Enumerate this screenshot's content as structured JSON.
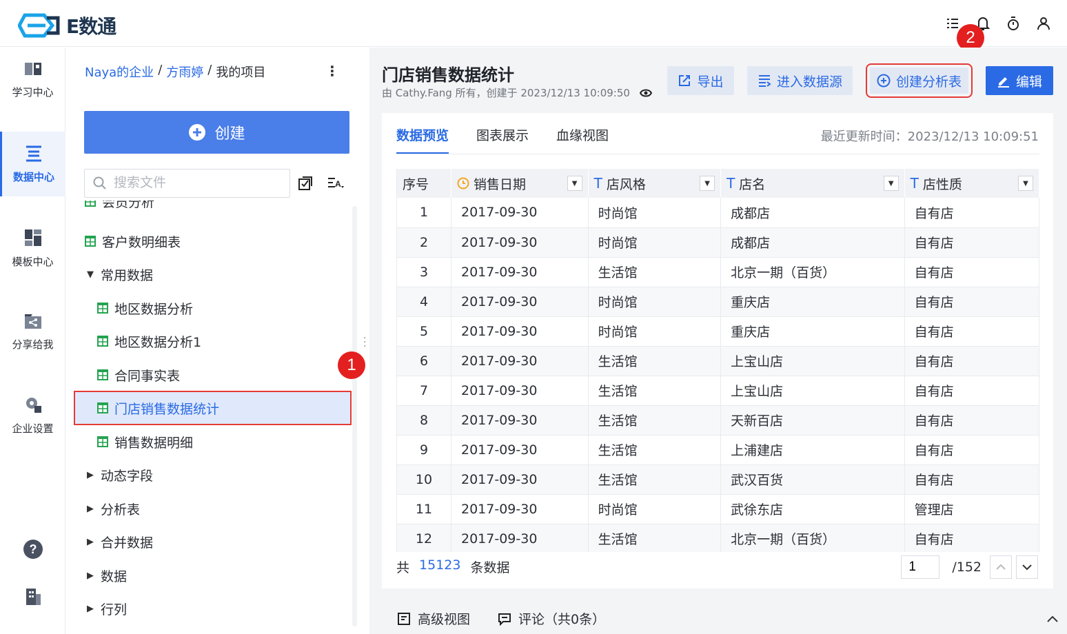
{
  "app": {
    "name": "E数通"
  },
  "nav": {
    "items": [
      {
        "label": "学习中心"
      },
      {
        "label": "数据中心"
      },
      {
        "label": "模板中心"
      },
      {
        "label": "分享给我"
      },
      {
        "label": "企业设置"
      }
    ]
  },
  "breadcrumb": {
    "org": "Naya的企业",
    "sep": "/",
    "user": "方雨婷",
    "project": "我的项目"
  },
  "filepanel": {
    "create_label": "创建",
    "search_placeholder": "搜索文件",
    "tree": [
      {
        "label": "会员分析"
      },
      {
        "label": "客户数明细表"
      },
      {
        "label": "常用数据"
      },
      {
        "label": "地区数据分析"
      },
      {
        "label": "地区数据分析1"
      },
      {
        "label": "合同事实表"
      },
      {
        "label": "门店销售数据统计"
      },
      {
        "label": "销售数据明细"
      },
      {
        "label": "动态字段"
      },
      {
        "label": "分析表"
      },
      {
        "label": "合并数据"
      },
      {
        "label": "数据"
      },
      {
        "label": "行列"
      }
    ]
  },
  "badges": {
    "one": "1",
    "two": "2"
  },
  "main": {
    "title": "门店销售数据统计",
    "meta": "由 Cathy.Fang 所有，创建于 2023/12/13 10:09:50",
    "buttons": {
      "export": "导出",
      "datasource": "进入数据源",
      "create_analysis": "创建分析表",
      "edit": "编辑"
    },
    "tabs": [
      "数据预览",
      "图表展示",
      "血缘视图"
    ],
    "updated": "最近更新时间：2023/12/13 10:09:51",
    "columns": [
      "序号",
      "销售日期",
      "店风格",
      "店名",
      "店性质"
    ],
    "rows": [
      [
        "1",
        "2017-09-30",
        "时尚馆",
        "成都店",
        "自有店"
      ],
      [
        "2",
        "2017-09-30",
        "时尚馆",
        "成都店",
        "自有店"
      ],
      [
        "3",
        "2017-09-30",
        "生活馆",
        "北京一期（百货）",
        "自有店"
      ],
      [
        "4",
        "2017-09-30",
        "时尚馆",
        "重庆店",
        "自有店"
      ],
      [
        "5",
        "2017-09-30",
        "时尚馆",
        "重庆店",
        "自有店"
      ],
      [
        "6",
        "2017-09-30",
        "生活馆",
        "上宝山店",
        "自有店"
      ],
      [
        "7",
        "2017-09-30",
        "生活馆",
        "上宝山店",
        "自有店"
      ],
      [
        "8",
        "2017-09-30",
        "生活馆",
        "天新百店",
        "自有店"
      ],
      [
        "9",
        "2017-09-30",
        "生活馆",
        "上浦建店",
        "自有店"
      ],
      [
        "10",
        "2017-09-30",
        "生活馆",
        "武汉百货",
        "自有店"
      ],
      [
        "11",
        "2017-09-30",
        "时尚馆",
        "武徐东店",
        "管理店"
      ],
      [
        "12",
        "2017-09-30",
        "生活馆",
        "北京一期（百货）",
        "自有店"
      ]
    ],
    "footer": {
      "prefix": "共",
      "count": "15123",
      "suffix": "条数据"
    },
    "pager": {
      "current": "1",
      "total": "/152"
    },
    "bottom": {
      "advanced": "高级视图",
      "comments": "评论（共0条）"
    }
  }
}
